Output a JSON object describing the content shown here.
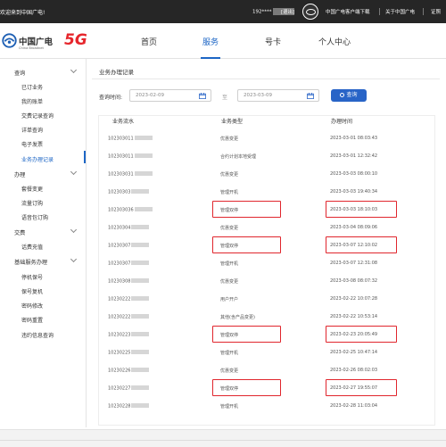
{
  "topbar": {
    "welcome": "欢迎来到中国广电!",
    "phone": "192****",
    "logout": "[退出]",
    "client_download": "中国广电客户端下载",
    "about": "关于中国广电",
    "cert": "证照"
  },
  "brand": {
    "cn": "中国广电",
    "en": "China Broadnet",
    "badge": "5G"
  },
  "nav": [
    "首页",
    "服务",
    "号卡",
    "个人中心"
  ],
  "nav_active": "服务",
  "sidebar": {
    "groups": [
      {
        "label": "查询",
        "items": [
          "已订业务",
          "我的账单",
          "交费记录查询",
          "详单查询",
          "电子发票",
          "业务办理记录"
        ]
      },
      {
        "label": "办理",
        "items": [
          "套餐变更",
          "流量订购",
          "语音包订购"
        ]
      },
      {
        "label": "交费",
        "items": [
          "话费充值"
        ]
      },
      {
        "label": "基础服务办理",
        "items": [
          "停机保号",
          "保号复机",
          "密码修改",
          "密码重置",
          "违约信息查询"
        ]
      }
    ],
    "active_item": "业务办理记录"
  },
  "panel": {
    "title": "业务办理记录",
    "query_label": "查询时间:",
    "start_date": "2023-02-09",
    "end_date": "2023-03-09",
    "to_label": "至",
    "query_button": "查询"
  },
  "table": {
    "headers": [
      "业务流水",
      "业务类型",
      "办理时间"
    ],
    "rows": [
      {
        "serial": "102303011",
        "type": "优惠变更",
        "time": "2023-03-01 08:03:43",
        "highlighted": false
      },
      {
        "serial": "102303011",
        "type": "合约计划本地受理",
        "time": "2023-03-01 12:32:42",
        "highlighted": false
      },
      {
        "serial": "102303031",
        "type": "优惠变更",
        "time": "2023-03-03 08:00:10",
        "highlighted": false
      },
      {
        "serial": "10230303",
        "type": "管理开机",
        "time": "2023-03-03 19:40:34",
        "highlighted": false
      },
      {
        "serial": "102303036",
        "type": "管理双停",
        "time": "2023-03-03 18:10:03",
        "highlighted": true
      },
      {
        "serial": "10230304",
        "type": "优惠变更",
        "time": "2023-03-04 08:09:06",
        "highlighted": false
      },
      {
        "serial": "10230307",
        "type": "管理双停",
        "time": "2023-03-07 12:10:02",
        "highlighted": true
      },
      {
        "serial": "10230307",
        "type": "管理开机",
        "time": "2023-03-07 12:31:08",
        "highlighted": false
      },
      {
        "serial": "10230308",
        "type": "优惠变更",
        "time": "2023-03-08 08:07:32",
        "highlighted": false
      },
      {
        "serial": "10230222",
        "type": "用户开户",
        "time": "2023-02-22 10:07:28",
        "highlighted": false
      },
      {
        "serial": "10230222",
        "type": "其他(含产品变更)",
        "time": "2023-02-22 10:53:14",
        "highlighted": false
      },
      {
        "serial": "10230223",
        "type": "管理双停",
        "time": "2023-02-23 20:05:49",
        "highlighted": true
      },
      {
        "serial": "10230225",
        "type": "管理开机",
        "time": "2023-02-25 10:47:14",
        "highlighted": false
      },
      {
        "serial": "10230226",
        "type": "优惠变更",
        "time": "2023-02-26 08:02:03",
        "highlighted": false
      },
      {
        "serial": "10230227",
        "type": "管理双停",
        "time": "2023-02-27 19:55:07",
        "highlighted": true
      },
      {
        "serial": "10230228",
        "type": "管理开机",
        "time": "2023-02-28 11:03:04",
        "highlighted": false
      }
    ]
  },
  "colors": {
    "accent": "#1d66c5",
    "button": "#2864c7",
    "highlight": "#e0262d",
    "brand_red": "#e6262c"
  }
}
